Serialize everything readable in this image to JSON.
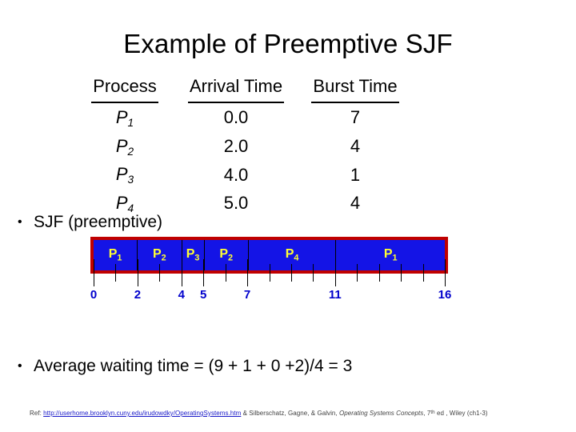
{
  "slide": {
    "title": "Example of Preemptive SJF"
  },
  "table": {
    "headers": [
      "Process",
      "Arrival Time",
      "Burst Time"
    ],
    "rows": [
      {
        "process": "P",
        "index": "1",
        "arrival": "0.0",
        "burst": "7"
      },
      {
        "process": "P",
        "index": "2",
        "arrival": "2.0",
        "burst": "4"
      },
      {
        "process": "P",
        "index": "3",
        "arrival": "4.0",
        "burst": "1"
      },
      {
        "process": "P",
        "index": "4",
        "arrival": "5.0",
        "burst": "4"
      }
    ]
  },
  "bullets": {
    "sjf": "SJF (preemptive)",
    "average": "Average waiting time = (9 + 1 + 0 +2)/4 = 3",
    "marker": "•"
  },
  "chart_data": {
    "type": "gantt",
    "title": "SJF (preemptive)",
    "xlabel": "",
    "ylabel": "",
    "xlim": [
      0,
      16
    ],
    "grid": false,
    "segments": [
      {
        "label": "P",
        "sub": "1",
        "start": 0,
        "end": 2
      },
      {
        "label": "P",
        "sub": "2",
        "start": 2,
        "end": 4
      },
      {
        "label": "P",
        "sub": "3",
        "start": 4,
        "end": 5
      },
      {
        "label": "P",
        "sub": "2",
        "start": 5,
        "end": 7
      },
      {
        "label": "P",
        "sub": "4",
        "start": 7,
        "end": 11
      },
      {
        "label": "P",
        "sub": "1",
        "start": 11,
        "end": 16
      }
    ],
    "tick_values": [
      0,
      1,
      2,
      3,
      4,
      5,
      6,
      7,
      8,
      9,
      10,
      11,
      12,
      13,
      14,
      15,
      16
    ],
    "labeled_ticks": [
      "0",
      "2",
      "4",
      "5",
      "7",
      "11",
      "16"
    ],
    "labeled_tick_values": [
      0,
      2,
      4,
      5,
      7,
      11,
      16
    ],
    "colors": {
      "bar_fill": "#1414E6",
      "bar_border": "#C00000",
      "bar_label": "#FFFF33",
      "tick_label": "#0000CC",
      "divider": "#000000"
    }
  },
  "footer": {
    "prefix": "Ref: ",
    "link": "http://userhome.brooklyn.cuny.edu/irudowdky/OperatingSystems.htm",
    "middle": " & Silberschatz, Gagne, & Galvin, ",
    "book": "Operating Systems Concepts",
    "edition_num": "7",
    "edition_sup": "th",
    "suffix": " ed , Wiley (ch1-3)"
  }
}
